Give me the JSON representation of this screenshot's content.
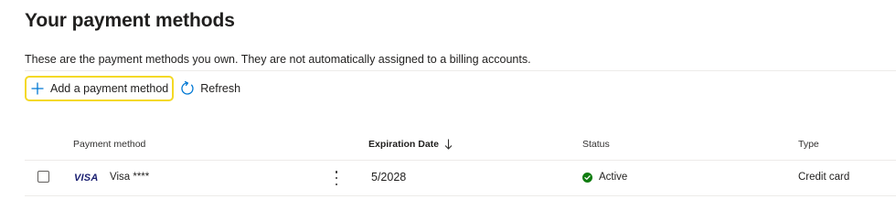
{
  "page": {
    "title": "Your payment methods",
    "description": "These are the payment methods you own. They are not automatically assigned to a billing accounts."
  },
  "toolbar": {
    "add_label": "Add a payment method",
    "refresh_label": "Refresh",
    "add_icon": "plus-icon",
    "refresh_icon": "refresh-icon",
    "focus_color": "#f4d925",
    "accent_color": "#0078d4"
  },
  "table": {
    "columns": {
      "payment_method": "Payment method",
      "expiration_date": "Expiration Date",
      "status": "Status",
      "type": "Type"
    },
    "sorted_column": "expiration_date",
    "sort_direction": "descending",
    "rows": [
      {
        "brand": "VISA",
        "name": "Visa ****",
        "expiration": "5/2028",
        "status": "Active",
        "status_color": "#107c10",
        "type": "Credit card",
        "selected": false
      }
    ]
  }
}
